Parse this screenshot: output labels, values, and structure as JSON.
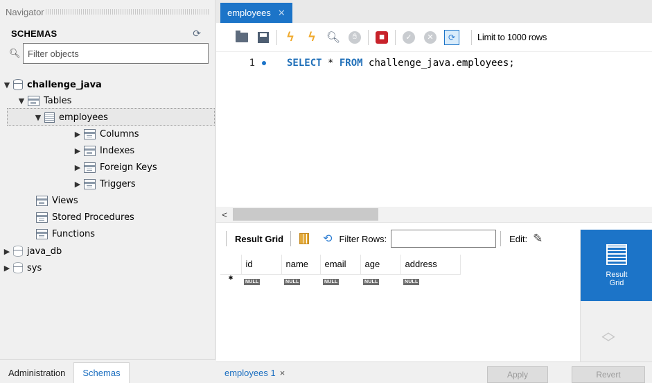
{
  "navigator": {
    "header": "Navigator",
    "schemas_title": "SCHEMAS",
    "filter_placeholder": "Filter objects",
    "tree": {
      "db1": "challenge_java",
      "tables": "Tables",
      "table": "employees",
      "columns": "Columns",
      "indexes": "Indexes",
      "foreign_keys": "Foreign Keys",
      "triggers": "Triggers",
      "views": "Views",
      "stored_procedures": "Stored Procedures",
      "functions": "Functions",
      "db2": "java_db",
      "db3": "sys"
    },
    "bottom_tabs": {
      "administration": "Administration",
      "schemas": "Schemas"
    }
  },
  "editor": {
    "tab_label": "employees",
    "limit_label": "Limit to 1000 rows",
    "line_number": "1",
    "sql": {
      "kw1": "SELECT",
      "star": " * ",
      "kw2": "FROM",
      "rest": " challenge_java.employees;"
    }
  },
  "result": {
    "grid_label": "Result Grid",
    "filter_label": "Filter Rows:",
    "edit_label": "Edit:",
    "columns": [
      "id",
      "name",
      "email",
      "age",
      "address"
    ],
    "null_text": "NULL",
    "side_button": "Result\nGrid",
    "side_button_line1": "Result",
    "side_button_line2": "Grid"
  },
  "bottom": {
    "result_tab": "employees 1",
    "apply": "Apply",
    "revert": "Revert"
  },
  "colors": {
    "accent": "#1c74c8",
    "keyword": "#1f6fb8",
    "bolt": "#f0a92c"
  }
}
